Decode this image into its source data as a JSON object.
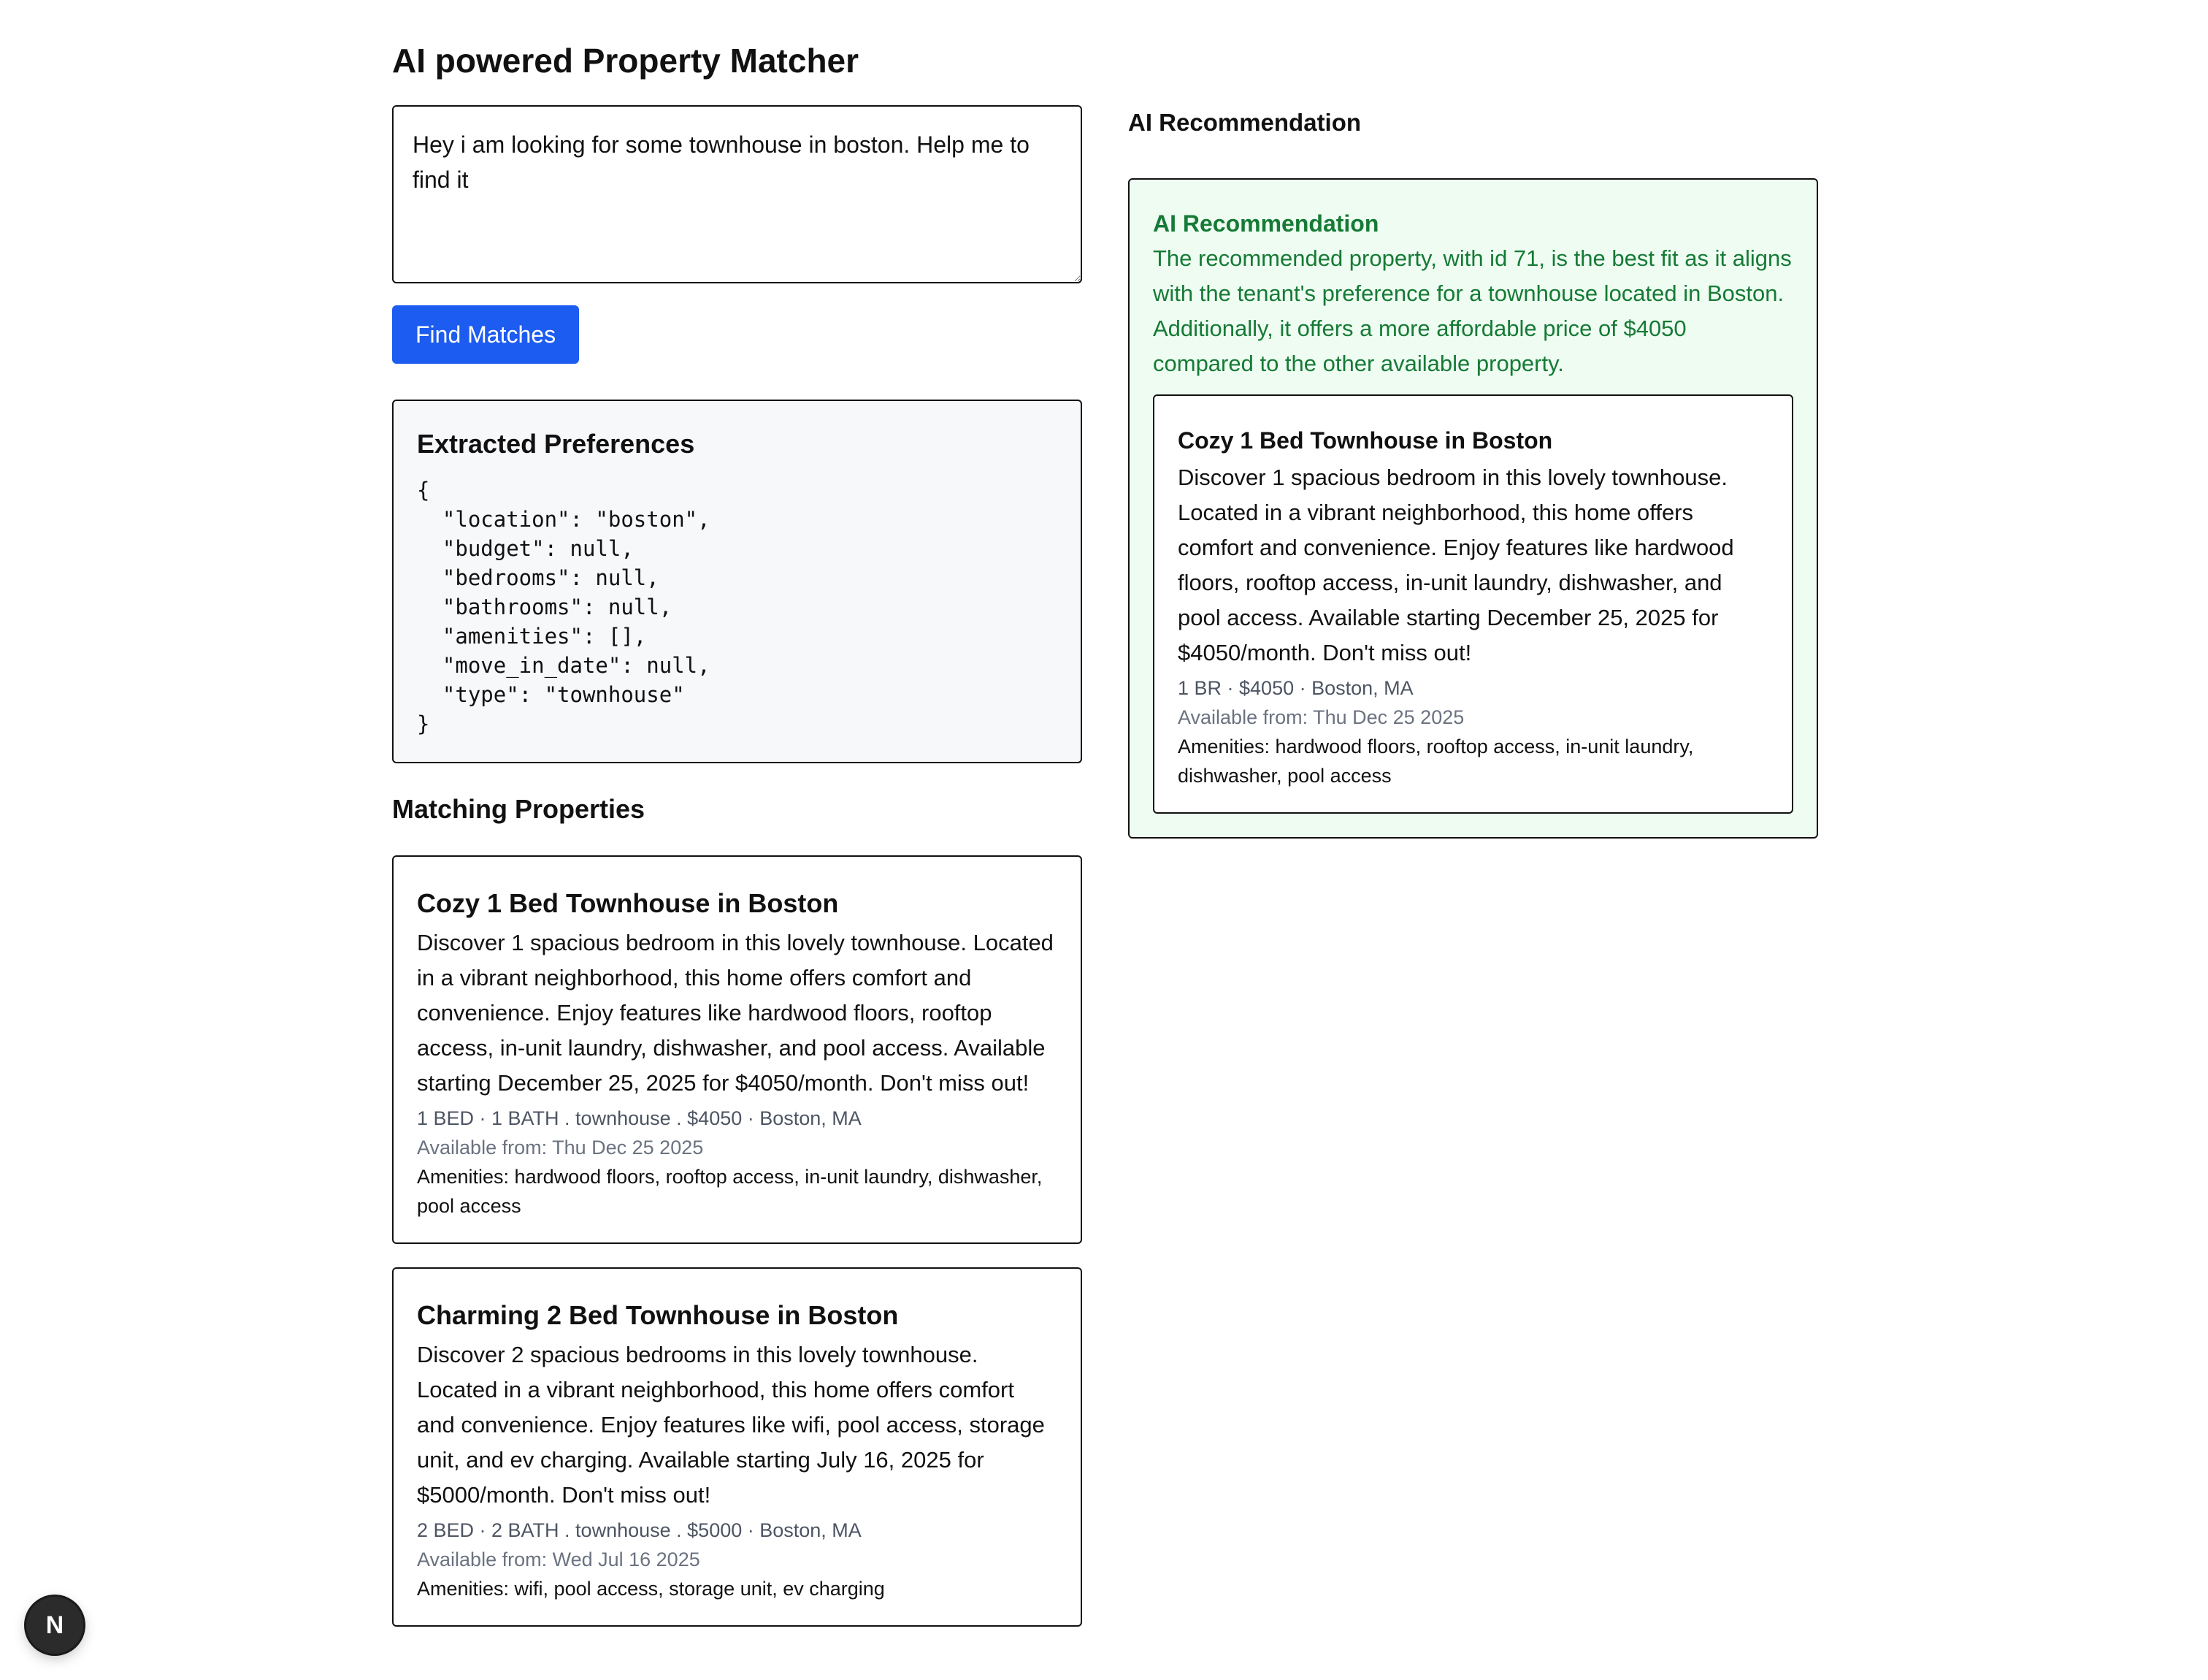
{
  "page": {
    "title": "AI powered Property Matcher"
  },
  "search": {
    "query": "Hey i am looking for some townhouse in boston. Help me to find it",
    "button_label": "Find Matches"
  },
  "preferences": {
    "heading": "Extracted Preferences",
    "json_text": "{\n  \"location\": \"boston\",\n  \"budget\": null,\n  \"bedrooms\": null,\n  \"bathrooms\": null,\n  \"amenities\": [],\n  \"move_in_date\": null,\n  \"type\": \"townhouse\"\n}"
  },
  "matches": {
    "heading": "Matching Properties",
    "items": [
      {
        "title": "Cozy 1 Bed Townhouse in Boston",
        "description": "Discover 1 spacious bedroom in this lovely townhouse. Located in a vibrant neighborhood, this home offers comfort and convenience. Enjoy features like hardwood floors, rooftop access, in-unit laundry, dishwasher, and pool access. Available starting December 25, 2025 for $4050/month. Don't miss out!",
        "meta": "1 BED · 1 BATH . townhouse . $4050 · Boston, MA",
        "available": "Available from: Thu Dec 25 2025",
        "amenities": "Amenities: hardwood floors, rooftop access, in-unit laundry, dishwasher, pool access"
      },
      {
        "title": "Charming 2 Bed Townhouse in Boston",
        "description": "Discover 2 spacious bedrooms in this lovely townhouse. Located in a vibrant neighborhood, this home offers comfort and convenience. Enjoy features like wifi, pool access, storage unit, and ev charging. Available starting July 16, 2025 for $5000/month. Don't miss out!",
        "meta": "2 BED · 2 BATH . townhouse . $5000 · Boston, MA",
        "available": "Available from: Wed Jul 16 2025",
        "amenities": "Amenities: wifi, pool access, storage unit, ev charging"
      }
    ]
  },
  "recommendation": {
    "section_heading": "AI Recommendation",
    "box_heading": "AI Recommendation",
    "text": "The recommended property, with id 71, is the best fit as it aligns with the tenant's preference for a townhouse located in Boston. Additionally, it offers a more affordable price of $4050 compared to the other available property.",
    "property": {
      "title": "Cozy 1 Bed Townhouse in Boston",
      "description": "Discover 1 spacious bedroom in this lovely townhouse. Located in a vibrant neighborhood, this home offers comfort and convenience. Enjoy features like hardwood floors, rooftop access, in-unit laundry, dishwasher, and pool access. Available starting December 25, 2025 for $4050/month. Don't miss out!",
      "meta": "1 BR · $4050 · Boston, MA",
      "available": "Available from: Thu Dec 25 2025",
      "amenities": "Amenities: hardwood floors, rooftop access, in-unit laundry, dishwasher, pool access"
    }
  },
  "dev_badge": {
    "label": "N",
    "icon": "nextjs-logo-icon"
  },
  "colors": {
    "primary_button": "#1d5cf0",
    "recommendation_text": "#167a35",
    "recommendation_background": "#eefcf2",
    "preferences_background": "#f7f8fa"
  }
}
